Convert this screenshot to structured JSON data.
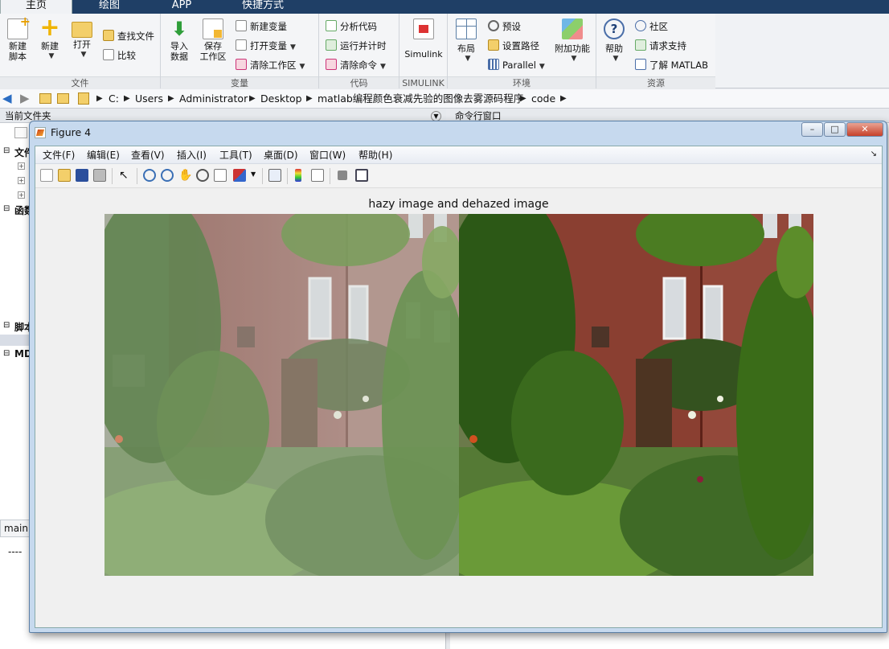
{
  "tabs": [
    "主页",
    "绘图",
    "APP",
    "快捷方式"
  ],
  "ribbon": {
    "file": {
      "label": "文件",
      "new_script": "新建\n脚本",
      "new": "新建",
      "open": "打开",
      "find_files": "查找文件",
      "compare": "比较"
    },
    "variable": {
      "label": "变量",
      "import": "导入\n数据",
      "save_ws": "保存\n工作区",
      "new_var": "新建变量",
      "open_var": "打开变量",
      "clear_ws": "清除工作区"
    },
    "code": {
      "label": "代码",
      "analyze": "分析代码",
      "run_time": "运行并计时",
      "clear_cmd": "清除命令"
    },
    "simulink": {
      "label": "SIMULINK",
      "button": "Simulink"
    },
    "env": {
      "label": "环境",
      "layout": "布局",
      "prefs": "预设",
      "set_path": "设置路径",
      "parallel": "Parallel",
      "addons": "附加功能"
    },
    "resources": {
      "label": "资源",
      "help": "帮助",
      "community": "社区",
      "support": "请求支持",
      "learn": "了解 MATLAB"
    }
  },
  "address": {
    "crumbs": [
      "C:",
      "Users",
      "Administrator",
      "Desktop",
      "matlab编程颜色衰减先验的图像去雾源码程序",
      "code"
    ]
  },
  "panes": {
    "current_folder": "当前文件夹",
    "command_window": "命令行窗口",
    "items": [
      "文件",
      "函数",
      "脚本",
      "MD"
    ],
    "editor_tab": "main.",
    "editor_line": "----"
  },
  "figure": {
    "title": "Figure 4",
    "menus": [
      "文件(F)",
      "编辑(E)",
      "查看(V)",
      "插入(I)",
      "工具(T)",
      "桌面(D)",
      "窗口(W)",
      "帮助(H)"
    ],
    "axes_title": "hazy image and dehazed image",
    "win_buttons": {
      "min": "–",
      "max": "□",
      "close": "✕"
    }
  },
  "toolbar_icons": [
    "new-figure-icon",
    "open-file-icon",
    "save-icon",
    "print-icon",
    "pointer-icon",
    "zoom-in-icon",
    "zoom-out-icon",
    "pan-icon",
    "rotate-icon",
    "data-cursor-icon",
    "brush-icon",
    "link-icon",
    "colorbar-icon",
    "legend-icon",
    "hide-plot-tools-icon",
    "show-plot-tools-icon"
  ],
  "colors": {
    "brand_bar": "#1f3f66",
    "figure_frame": "#c6d9ee"
  }
}
